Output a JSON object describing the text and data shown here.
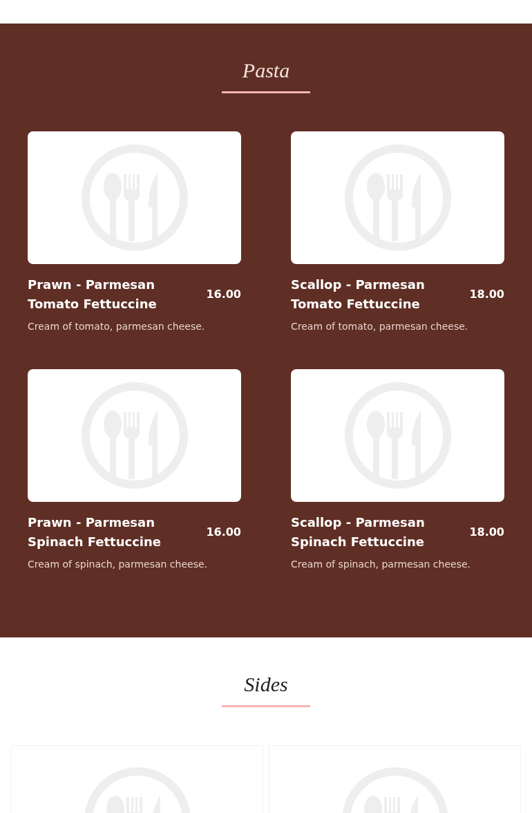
{
  "sections": [
    {
      "title": "Pasta",
      "kind": "dark",
      "items": [
        {
          "kind": "dish",
          "name": "Prawn - Parmesan Tomato Fettuccine",
          "price": "16.00",
          "description": "Cream of tomato, parmesan cheese."
        },
        {
          "kind": "dish",
          "name": "Scallop - Parmesan Tomato Fettuccine",
          "price": "18.00",
          "description": "Cream of tomato, parmesan cheese."
        },
        {
          "kind": "dish",
          "name": "Prawn - Parmesan Spinach Fettuccine",
          "price": "16.00",
          "description": "Cream of spinach, parmesan cheese."
        },
        {
          "kind": "dish",
          "name": "Scallop - Parmesan Spinach Fettuccine",
          "price": "18.00",
          "description": "Cream of spinach, parmesan cheese."
        }
      ]
    },
    {
      "title": "Sides",
      "kind": "light",
      "items": [
        {
          "kind": "card"
        },
        {
          "kind": "card"
        }
      ]
    }
  ]
}
